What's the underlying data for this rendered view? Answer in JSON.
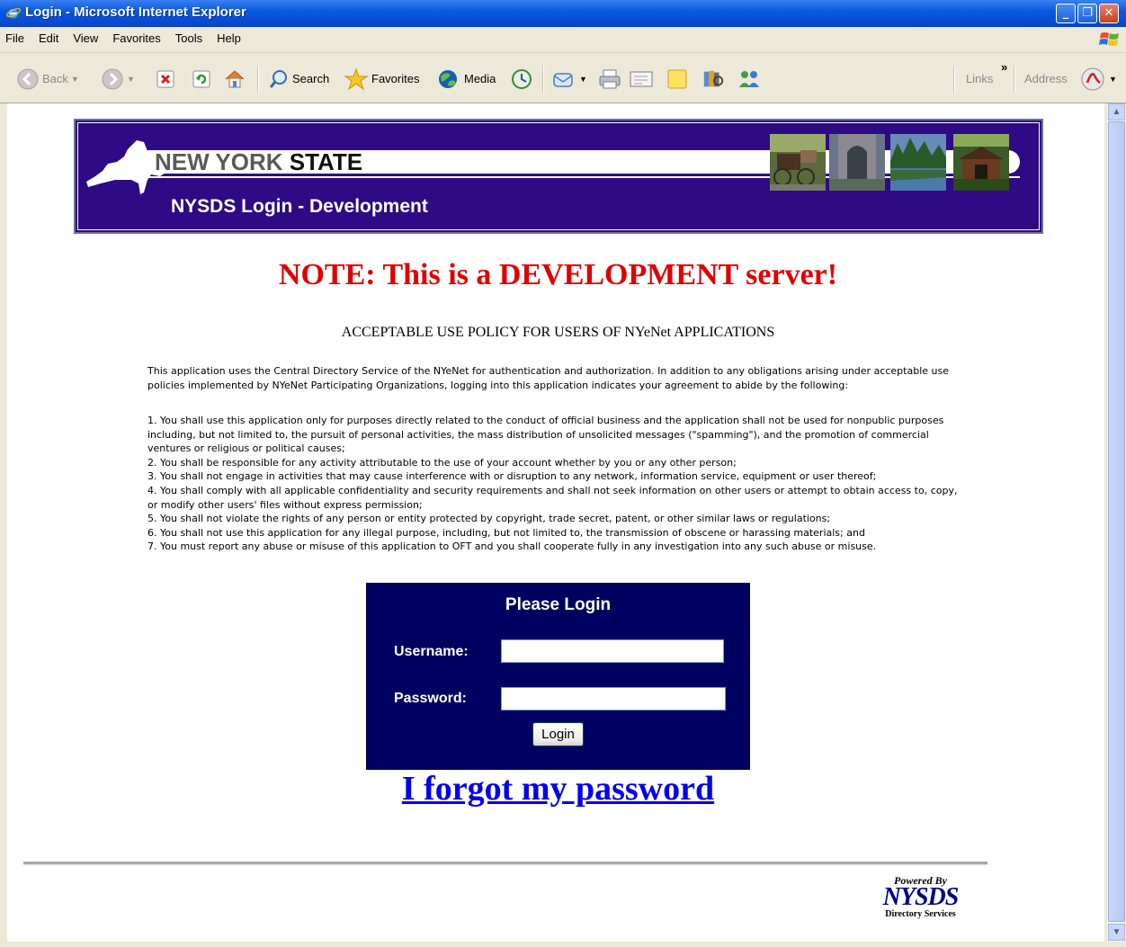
{
  "window": {
    "title": "Login - Microsoft Internet Explorer",
    "minimize": "_",
    "maximize": "❐",
    "close": "✕"
  },
  "menu": [
    "File",
    "Edit",
    "View",
    "Favorites",
    "Tools",
    "Help"
  ],
  "toolbar": {
    "back": "Back",
    "search": "Search",
    "favorites": "Favorites",
    "media": "Media",
    "links": "Links",
    "address": "Address",
    "chevron": "»"
  },
  "banner": {
    "state_part1": "NEW YORK",
    "state_part2": "STATE",
    "subtitle": "NYSDS Login - Development"
  },
  "note": "NOTE: This is a DEVELOPMENT server!",
  "policy": {
    "title": "ACCEPTABLE USE POLICY FOR USERS OF NYeNet APPLICATIONS",
    "intro": "This application uses the Central Directory Service of the NYeNet for authentication and authorization. In addition to any obligations arising under acceptable use policies implemented by NYeNet Participating Organizations, logging into this application indicates your agreement to abide by the following:",
    "rules": [
      "1. You shall use this application only for purposes directly related to the conduct of official business and the application shall not be used for nonpublic purposes including, but not limited to, the pursuit of personal activities, the mass distribution of unsolicited messages (\"spamming\"), and the promotion of commercial ventures or religious or political causes;",
      "2. You shall be responsible for any activity attributable to the use of your account whether by you or any other person;",
      "3. You shall not engage in activities that may cause interference with or disruption to any network, information service, equipment or user thereof;",
      "4. You shall comply with all applicable confidentiality and security requirements and shall not seek information on other users or attempt to obtain access to, copy, or modify other users' files without express permission;",
      "5. You shall not violate the rights of any person or entity protected by copyright, trade secret, patent, or other similar laws or regulations;",
      "6. You shall not use this application for any illegal purpose, including, but not limited to, the transmission of obscene or harassing materials; and",
      "7. You must report any abuse or misuse of this application to OFT and you shall cooperate fully in any investigation into any such abuse or misuse."
    ]
  },
  "login": {
    "heading": "Please Login",
    "username_label": "Username:",
    "username_value": "",
    "password_label": "Password:",
    "password_value": "",
    "button": "Login"
  },
  "forgot_link": "I forgot my password",
  "footer": {
    "powered_by": "Powered By",
    "brand": "NYSDS",
    "tagline": "Directory Services"
  },
  "colors": {
    "banner_bg": "#2E0A85",
    "login_bg": "#000060",
    "note_red": "#E00000",
    "link_blue": "#0000EE"
  }
}
